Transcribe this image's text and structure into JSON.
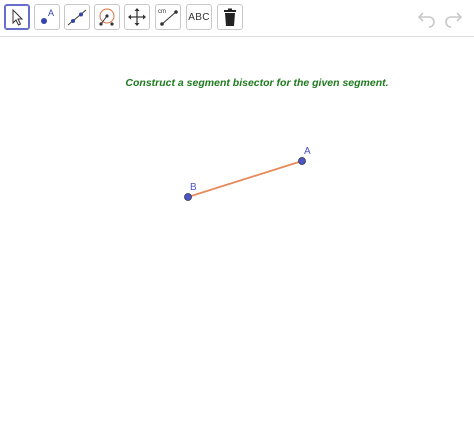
{
  "toolbar": {
    "tools": [
      {
        "name": "move-tool",
        "icon": "arrow-cursor-icon"
      },
      {
        "name": "point-tool",
        "icon": "point-icon",
        "label": "A"
      },
      {
        "name": "line-tool",
        "icon": "line-through-points-icon"
      },
      {
        "name": "circle-tool",
        "icon": "compass-circle-icon"
      },
      {
        "name": "move-graphics-view-tool",
        "icon": "four-arrows-icon"
      },
      {
        "name": "distance-tool",
        "icon": "ruler-icon",
        "label": "cm"
      },
      {
        "name": "text-tool",
        "icon": "text-icon",
        "label": "ABC"
      },
      {
        "name": "delete-tool",
        "icon": "trash-icon"
      }
    ],
    "undo_icon": "undo-icon",
    "redo_icon": "redo-icon"
  },
  "instruction": "Construct a segment bisector for the given segment.",
  "construction": {
    "point_a_label": "A",
    "point_b_label": "B",
    "segment_color": "#e8895a",
    "point_color": "#4a55cc"
  },
  "colors": {
    "accent": "#666ecc",
    "instruction": "#1e7a1e"
  }
}
